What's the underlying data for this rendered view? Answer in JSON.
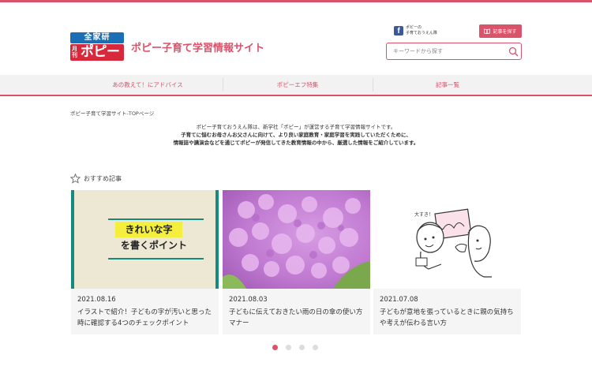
{
  "brand": {
    "logo_top": "全家研",
    "logo_small": "月刊",
    "logo_main": "ポピー",
    "site_title": "ポピー子育て学習情報サイト",
    "accent": "#d9536b"
  },
  "header": {
    "facebook_line1": "ポピーの",
    "facebook_line2": "子育ておうえん隊",
    "find_articles": "記事を探す",
    "search_placeholder": "キーワードから探す"
  },
  "nav": {
    "items": [
      {
        "label": "あの教えて！にアドバイス"
      },
      {
        "label": "ポピーエフ特集"
      },
      {
        "label": "記事一覧"
      }
    ]
  },
  "breadcrumb": "ポピー子育て学習サイト-TOPページ",
  "intro": {
    "line1": "ポピー子育ておうえん隊は、新学社「ポピー」が運営する子育て学習情報サイトです。",
    "line2": "子育てに悩むお母さんお父さんに向けて、より良い家庭教育・家庭学習を実践していただくために、",
    "line3": "情報誌や講演会などを通じてポピーが発信してきた教育情報の中から、厳選した情報をご紹介しています。"
  },
  "recommended": {
    "heading": "おすすめ記事",
    "cards": [
      {
        "image_line1": "きれいな字",
        "image_line2": "を書くポイント",
        "date": "2021.08.16",
        "title": "イラストで紹介！子どもの字が汚いと思った時に確認する4つのチェックポイント"
      },
      {
        "date": "2021.08.03",
        "title": "子どもに伝えておきたい雨の日の傘の使い方マナー"
      },
      {
        "image_text": "大すき！",
        "date": "2021.07.08",
        "title": "子どもが意地を張っているときに親の気持ちや考えが伝わる言い方"
      }
    ]
  },
  "carousel": {
    "pages": 4,
    "active": 1
  }
}
